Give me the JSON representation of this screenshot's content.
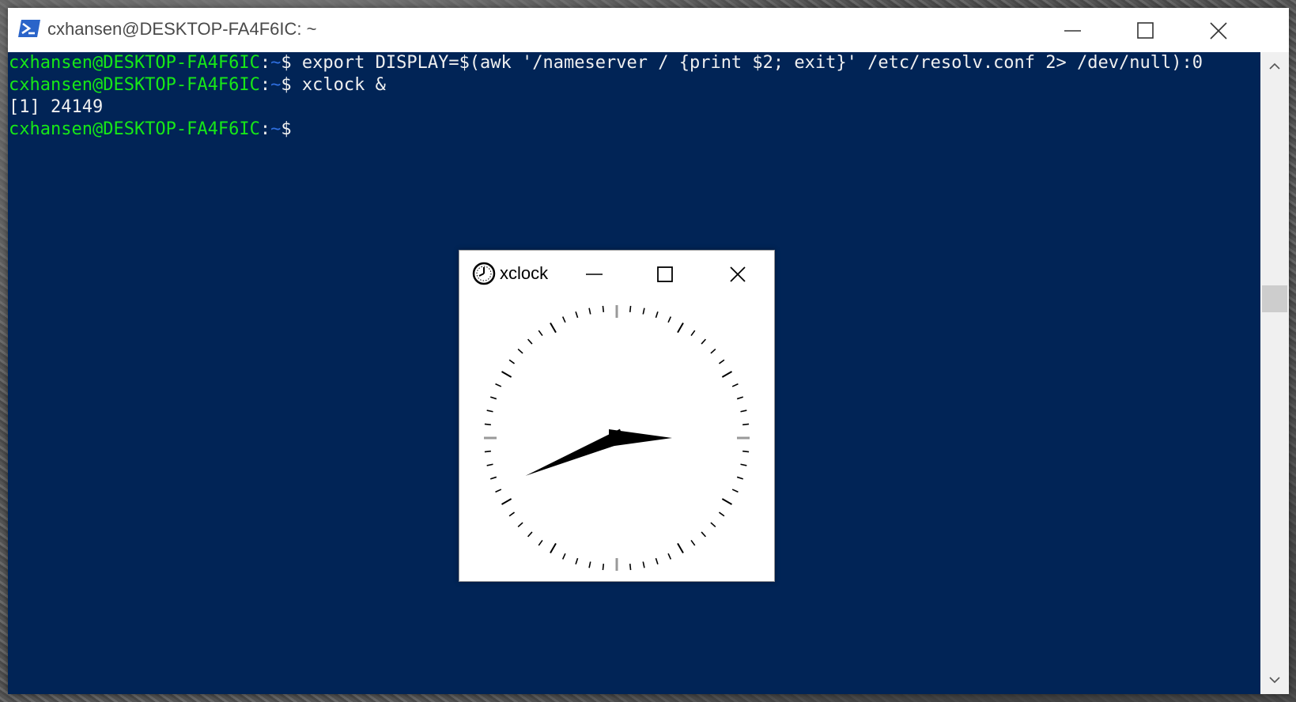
{
  "terminal": {
    "title": "cxhansen@DESKTOP-FA4F6IC: ~",
    "lines": [
      {
        "user": "cxhansen@DESKTOP-FA4F6IC",
        "sep": ":",
        "path": "~",
        "prompt": "$",
        "command": " export DISPLAY=$(awk '/nameserver / {print $2; exit}' /etc/resolv.conf 2> /dev/null):0"
      },
      {
        "user": "cxhansen@DESKTOP-FA4F6IC",
        "sep": ":",
        "path": "~",
        "prompt": "$",
        "command": " xclock &"
      },
      {
        "output": "[1] 24149"
      },
      {
        "user": "cxhansen@DESKTOP-FA4F6IC",
        "sep": ":",
        "path": "~",
        "prompt": "$",
        "command": ""
      }
    ],
    "icons": {
      "app": "powershell-icon",
      "minimize": "minimize-icon",
      "maximize": "maximize-icon",
      "close": "close-icon",
      "scroll_up": "chevron-up-icon",
      "scroll_down": "chevron-down-icon"
    },
    "colors": {
      "background": "#012456",
      "user": "#17e817",
      "path": "#2f6fe0",
      "text": "#f0f0f0"
    }
  },
  "xclock": {
    "title": "xclock",
    "time": {
      "hour": 8,
      "minute": 15
    },
    "icons": {
      "app": "clock-icon",
      "minimize": "minimize-icon",
      "maximize": "maximize-icon",
      "close": "close-icon"
    }
  }
}
